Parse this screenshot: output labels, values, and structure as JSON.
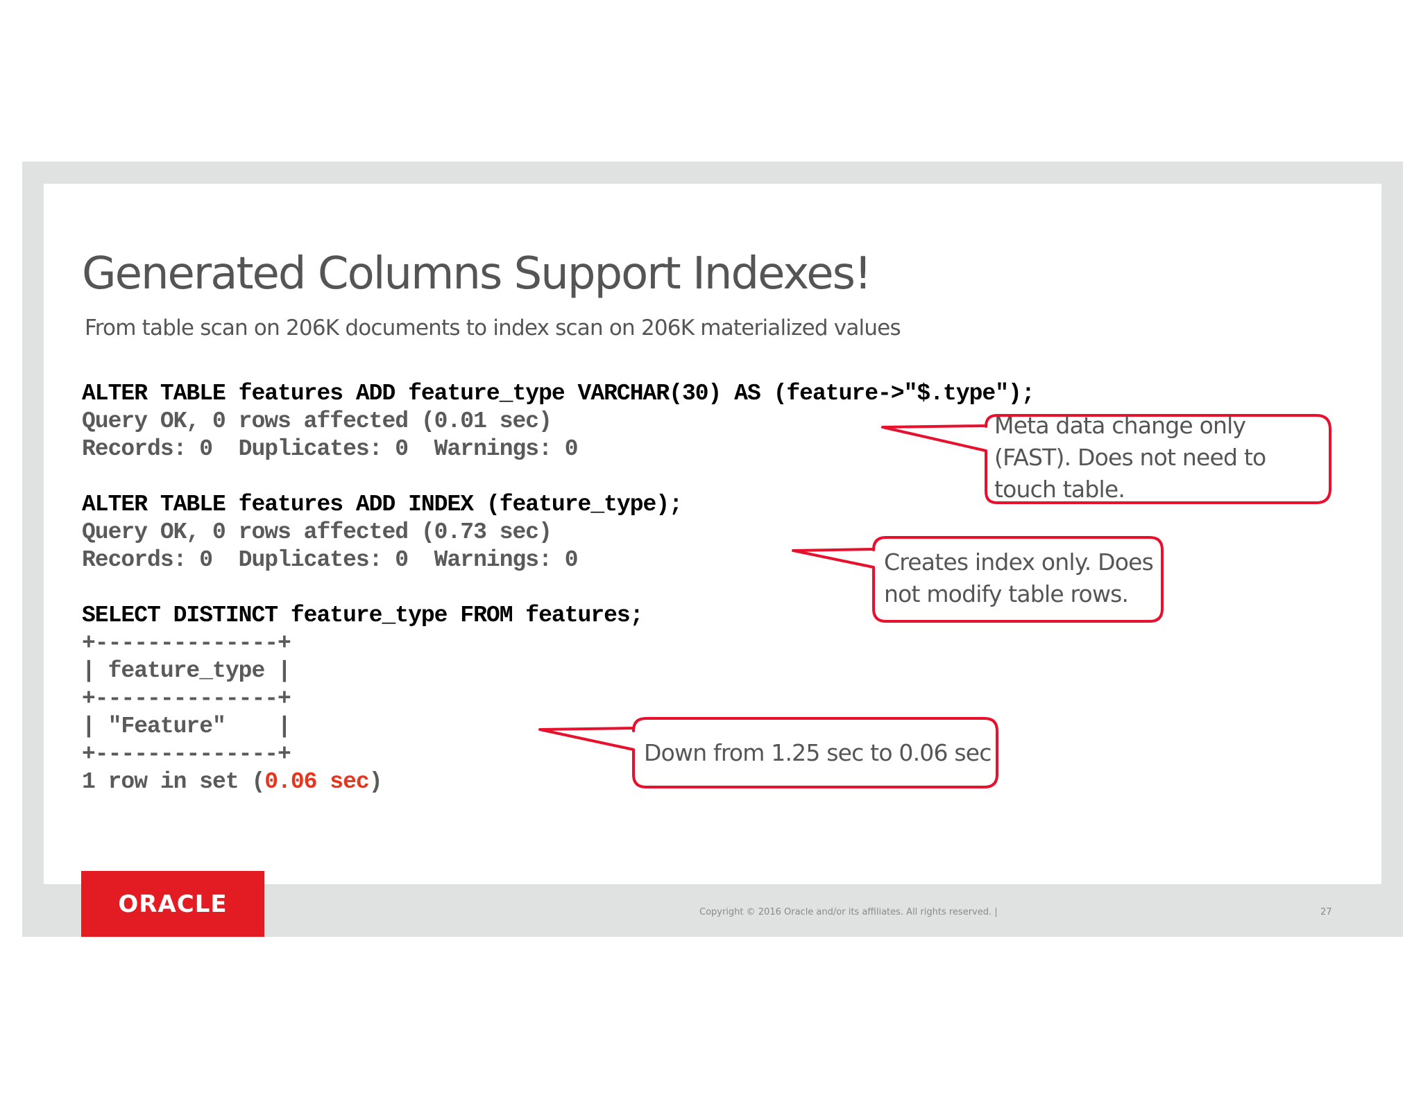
{
  "slide": {
    "title": "Generated Columns Support Indexes!",
    "subtitle": "From table scan on 206K documents to index scan on 206K materialized  values"
  },
  "code": {
    "block1": {
      "command": "ALTER TABLE features ADD feature_type VARCHAR(30) AS (feature->\"$.type\");",
      "output_line1": "Query OK, 0 rows affected (0.01 sec)",
      "output_line2": "Records: 0  Duplicates: 0  Warnings: 0"
    },
    "block2": {
      "command": "ALTER TABLE features ADD INDEX (feature_type);",
      "output_line1": "Query OK, 0 rows affected (0.73 sec)",
      "output_line2": "Records: 0  Duplicates: 0  Warnings: 0"
    },
    "block3": {
      "command": "SELECT DISTINCT feature_type FROM features;",
      "table_lines": [
        "+--------------+",
        "| feature_type |",
        "+--------------+",
        "| \"Feature\"    |",
        "+--------------+"
      ],
      "result_prefix": "1 row in set (",
      "result_time": "0.06 sec",
      "result_suffix": ")"
    }
  },
  "callouts": {
    "meta": {
      "line1": "Meta data change only",
      "line2": "(FAST). Does not need to",
      "line3": "touch table."
    },
    "index": {
      "line1": "Creates index only. Does",
      "line2": "not modify table rows."
    },
    "time": {
      "line1": "Down from 1.25 sec to 0.06 sec"
    }
  },
  "footer": {
    "logo": "ORACLE",
    "copyright": "Copyright  © 2016 Oracle and/or  its affiliates.  All rights reserved.   |",
    "page_number": "27"
  },
  "colors": {
    "accent_red": "#e31b23",
    "highlight": "#e6361e",
    "callout_border": "#e8112d",
    "frame": "#dfe2e0",
    "text_gray": "#555555"
  }
}
